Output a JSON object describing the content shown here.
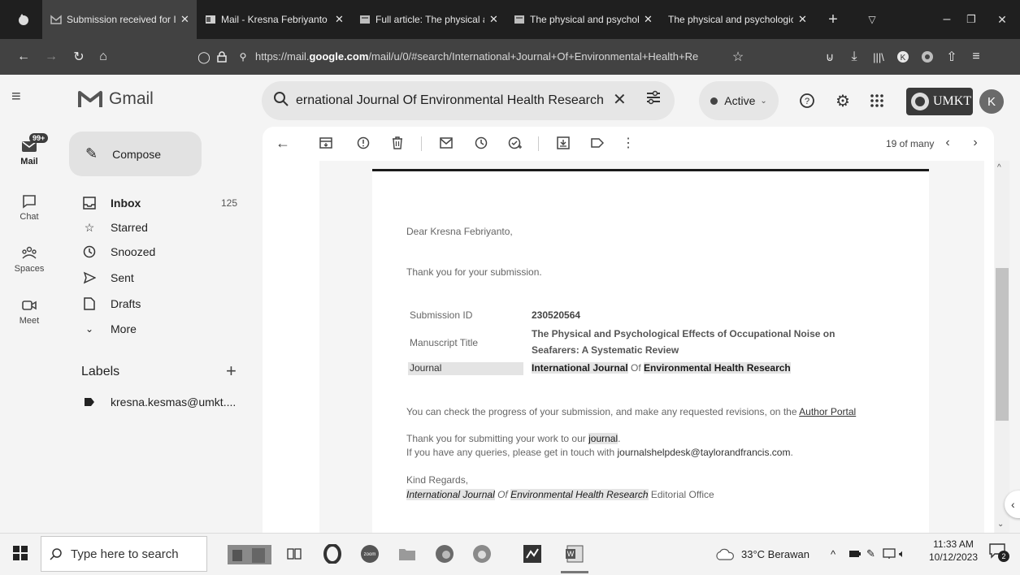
{
  "browser": {
    "tabs": [
      {
        "title": "Submission received for Ir",
        "active": true
      },
      {
        "title": "Mail - Kresna Febriyanto -",
        "active": false
      },
      {
        "title": "Full article: The physical ar",
        "active": false
      },
      {
        "title": "The physical and psycholo",
        "active": false
      },
      {
        "title": "The physical and psychologica",
        "active": false
      }
    ],
    "url_prefix": "https://mail.",
    "url_domain": "google.com",
    "url_rest": "/mail/u/0/#search/International+Journal+Of+Environmental+Health+Re"
  },
  "gmail": {
    "logo": "Gmail",
    "search_query": "ernational Journal Of Environmental Health Research",
    "status": "Active",
    "rail": [
      {
        "label": "Mail",
        "badge": "99+"
      },
      {
        "label": "Chat"
      },
      {
        "label": "Spaces"
      },
      {
        "label": "Meet"
      }
    ],
    "compose_label": "Compose",
    "folders": [
      {
        "label": "Inbox",
        "count": "125"
      },
      {
        "label": "Starred"
      },
      {
        "label": "Snoozed"
      },
      {
        "label": "Sent"
      },
      {
        "label": "Drafts"
      },
      {
        "label": "More"
      }
    ],
    "labels_heading": "Labels",
    "labels": [
      {
        "label": "kresna.kesmas@umkt...."
      }
    ],
    "pagination": "19 of many",
    "org_logo": "UMKT"
  },
  "email": {
    "greeting": "Dear Kresna Febriyanto,",
    "thanks": "Thank you for your submission.",
    "submission_id_label": "Submission ID",
    "submission_id": "230520564",
    "manuscript_label": "Manuscript Title",
    "manuscript_line1": "The Physical and Psychological Effects of Occupational Noise on",
    "manuscript_line2": "Seafarers: A Systematic Review",
    "journal_label": "Journal",
    "journal_name_a": "International Journal",
    "journal_name_of": " Of ",
    "journal_name_b": "Environmental Health Research",
    "progress_text": "You can check the progress of your submission, and make any requested revisions, on the ",
    "author_portal": "Author Portal",
    "thank_submit_a": "Thank you for submitting your work to our ",
    "thank_submit_b": "journal",
    "thank_submit_c": ".",
    "queries_text": "If you have any queries, please get in touch with ",
    "helpdesk_email": "journalshelpdesk@taylorandfrancis.com",
    "queries_end": ".",
    "regards": "Kind Regards,",
    "sig_a": "International Journal",
    "sig_of": " Of ",
    "sig_b": "Environmental Health Research",
    "sig_end": " Editorial Office"
  },
  "taskbar": {
    "search_placeholder": "Type here to search",
    "weather": "33°C  Berawan",
    "time": "11:33 AM",
    "date": "10/12/2023",
    "notifications": "2"
  }
}
